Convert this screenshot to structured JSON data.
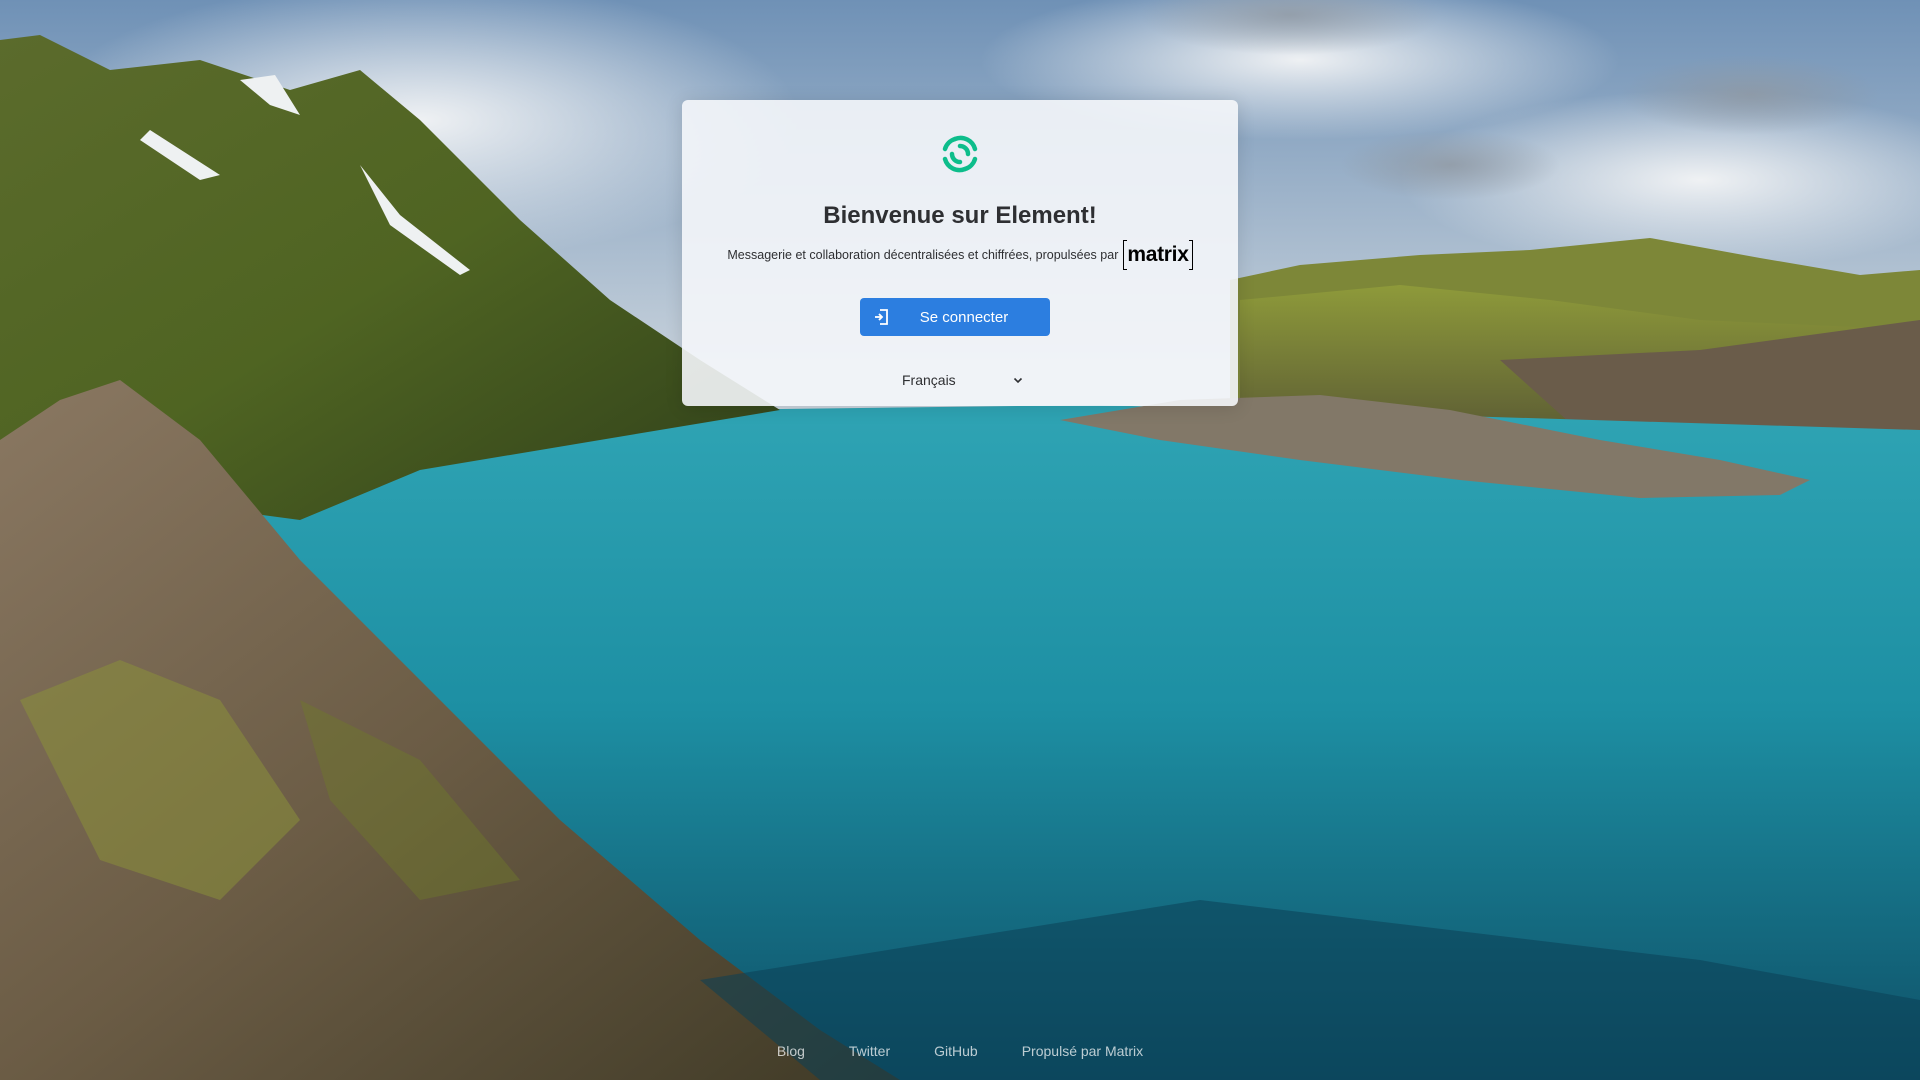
{
  "welcome": {
    "title": "Bienvenue sur Element!",
    "subtitle": "Messagerie et collaboration décentralisées et chiffrées, propulsées par",
    "matrix_wordmark": "matrix",
    "login_button": "Se connecter",
    "language": "Français"
  },
  "icons": {
    "logo": "element-logo",
    "login": "login-icon",
    "language_chevron": "chevron-down-icon"
  },
  "colors": {
    "accent": "#2c7ee0",
    "element_green": "#0dbd8b"
  },
  "footer": {
    "links": [
      "Blog",
      "Twitter",
      "GitHub",
      "Propulsé par Matrix"
    ]
  }
}
